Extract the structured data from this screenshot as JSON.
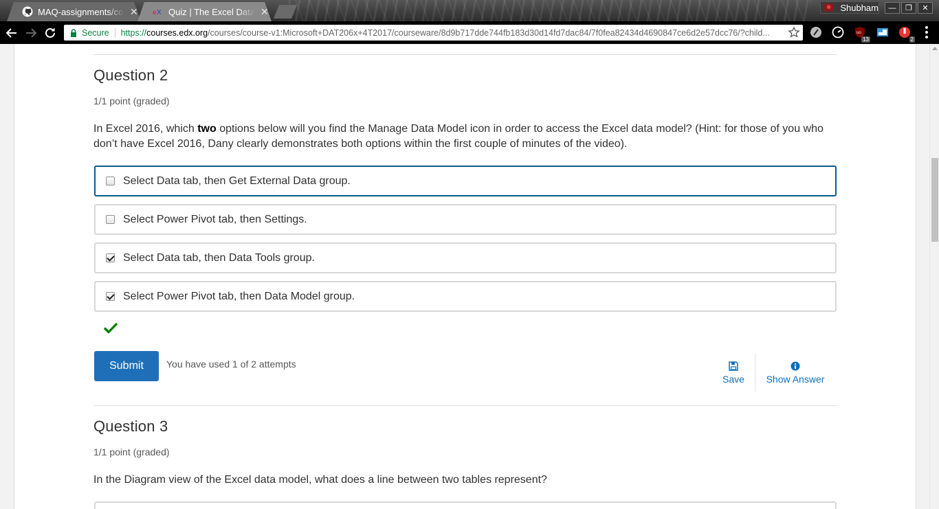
{
  "browser": {
    "tabs": [
      {
        "title": "MAQ-assignments/co",
        "icon": "github-icon",
        "active": false
      },
      {
        "title": "Quiz | The Excel Data",
        "icon": "edx-icon",
        "active": true
      }
    ],
    "profile_name": "Shubham",
    "url": {
      "secure_label": "Secure",
      "scheme": "https://",
      "host": "courses.edx.org",
      "path": "/courses/course-v1:Microsoft+DAT206x+4T2017/courseware/8d9b717dde744fb183d30d14fd7dac84/7f0fea82434d4690847ce6d2e57dcc76/?child..."
    },
    "extensions": [
      {
        "name": "ghostery-icon",
        "badge": ""
      },
      {
        "name": "speed-dial-icon",
        "badge": ""
      },
      {
        "name": "ublock-icon",
        "badge": "13"
      },
      {
        "name": "cast-icon",
        "badge": ""
      },
      {
        "name": "shield-extension-icon",
        "badge": "2"
      }
    ]
  },
  "question2": {
    "title": "Question 2",
    "points": "1/1 point (graded)",
    "text_before": "In Excel 2016, which ",
    "text_bold": "two",
    "text_after": " options below will you find the Manage Data Model icon in order to access the Excel data model? (Hint: for those of you who don’t have Excel 2016, Dany clearly demonstrates both options within the first couple of minutes of the video).",
    "choices": [
      {
        "label": "Select Data tab, then Get External Data group.",
        "checked": false
      },
      {
        "label": "Select Power Pivot tab, then Settings.",
        "checked": false
      },
      {
        "label": "Select Data tab, then Data Tools group.",
        "checked": true
      },
      {
        "label": "Select Power Pivot tab, then Data Model group.",
        "checked": true
      }
    ],
    "submit_label": "Submit",
    "attempts_text": "You have used 1 of 2 attempts",
    "save_label": "Save",
    "show_answer_label": "Show Answer"
  },
  "question3": {
    "title": "Question 3",
    "points": "1/1 point (graded)",
    "text": "In the Diagram view of the Excel data model, what does a line between two tables represent?"
  },
  "colors": {
    "accent": "#1f6fb8",
    "link": "#0e6fb8",
    "correct": "#008100",
    "focus_border": "#0e5a8a"
  }
}
